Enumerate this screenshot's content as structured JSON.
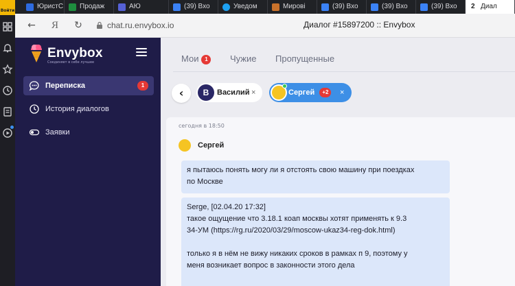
{
  "rail": {
    "login_label": "Войти"
  },
  "browser_tabs": [
    {
      "label": "ЮристС",
      "favicon_color": "#2d6be0"
    },
    {
      "label": "Продаж",
      "favicon_color": "#1e8e3e"
    },
    {
      "label": "АЮ",
      "favicon_color": "#5561d6"
    },
    {
      "label": "(39) Вхо",
      "favicon_color": "#3b82f6"
    },
    {
      "label": "Уведом",
      "favicon_color": "#1da1f2"
    },
    {
      "label": "Мирові",
      "favicon_color": "#c9722b"
    },
    {
      "label": "(39) Вхо",
      "favicon_color": "#3b82f6"
    },
    {
      "label": "(39) Вхо",
      "favicon_color": "#3b82f6"
    },
    {
      "label": "(39) Вхо",
      "favicon_color": "#3b82f6"
    },
    {
      "label": "Диал",
      "num": "2",
      "active": true
    }
  ],
  "address": {
    "url": "chat.ru.envybox.io",
    "page_title": "Диалог #15897200 :: Envybox"
  },
  "sidebar": {
    "brand": "Envybox",
    "tagline": "Соединяет в себе лучшее",
    "items": [
      {
        "label": "Переписка",
        "badge": "1",
        "active": true
      },
      {
        "label": "История диалогов"
      },
      {
        "label": "Заявки"
      }
    ]
  },
  "filters": {
    "mine": "Мои",
    "mine_badge": "1",
    "others": "Чужие",
    "missed": "Пропущенные"
  },
  "chips": {
    "first": {
      "initial": "В",
      "name": "Василий",
      "close": "×"
    },
    "second": {
      "name": "Сергей",
      "extra": "+2",
      "close": "×"
    }
  },
  "conversation": {
    "time": "сегодня в 18:50",
    "sender": "Сергей",
    "message1": [
      "я пытаюсь понять могу ли я отстоять свою машину при поездках",
      "по Москве"
    ],
    "message2": [
      "Serge, [02.04.20 17:32]",
      "такое ощущение что 3.18.1 коап москвы хотят применять к 9.3",
      "34-УМ (https://rg.ru/2020/03/29/moscow-ukaz34-reg-dok.html)",
      "",
      "только я в нём не вижу никаких сроков в рамках п 9, поэтому у",
      "меня возникает вопрос в законности этого дела"
    ]
  },
  "colors": {
    "sidebar_bg": "#1f1c48",
    "accent_blue": "#3d8fe6",
    "badge_red": "#e53935",
    "bubble_bg": "#dce7fa",
    "avatar_yellow": "#f5c423"
  }
}
